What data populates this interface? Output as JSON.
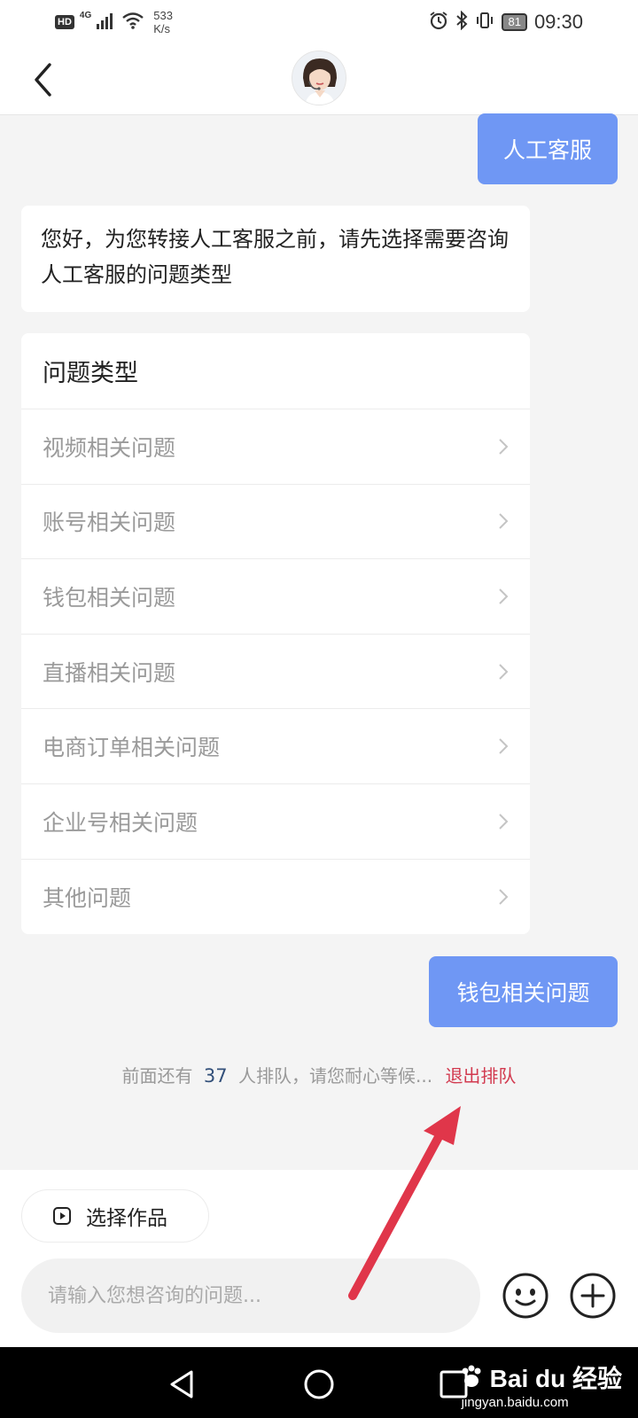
{
  "status_bar": {
    "hd_label": "HD",
    "network_generation": "4G",
    "speed_value": "533",
    "speed_unit": "K/s",
    "battery_level": "81",
    "time": "09:30",
    "icons": [
      "signal-icon",
      "wifi-icon",
      "alarm-icon",
      "bluetooth-icon",
      "vibrate-icon",
      "battery-icon"
    ]
  },
  "header": {
    "back_icon": "chevron-left-icon",
    "avatar": "customer-service-avatar"
  },
  "chat": {
    "user_message_1": "人工客服",
    "bot_message": "您好，为您转接人工客服之前，请先选择需要咨询人工客服的问题类型",
    "question_card": {
      "title": "问题类型",
      "items": [
        {
          "label": "视频相关问题"
        },
        {
          "label": "账号相关问题"
        },
        {
          "label": "钱包相关问题"
        },
        {
          "label": "直播相关问题"
        },
        {
          "label": "电商订单相关问题"
        },
        {
          "label": "企业号相关问题"
        },
        {
          "label": "其他问题"
        }
      ]
    },
    "user_message_2": "钱包相关问题",
    "queue": {
      "prefix": "前面还有",
      "count": "37",
      "suffix": "人排队，请您耐心等候...",
      "exit_label": "退出排队"
    }
  },
  "input_area": {
    "pick_work_label": "选择作品",
    "input_placeholder": "请输入您想咨询的问题...",
    "emoji_icon": "emoji-icon",
    "plus_icon": "plus-circle-icon"
  },
  "nav_bar": {
    "watermark_logo": "Bai du 经验",
    "watermark_url": "jingyan.baidu.com"
  },
  "colors": {
    "accent_blue": "#6f97f4",
    "exit_red": "#d23a4f",
    "annotation_red": "#e0364a",
    "background": "#f4f4f4"
  }
}
